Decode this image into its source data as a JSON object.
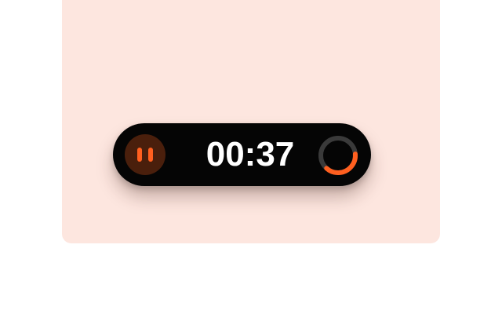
{
  "timer": {
    "time": "00:37",
    "state": "running",
    "progress": 0.38,
    "pause_icon": "pause-icon"
  },
  "colors": {
    "accent": "#ff5f1f",
    "pill_background": "#050505",
    "pause_button_background": "#4a1f0c",
    "ring_track": "#3a3a3a",
    "stage_background": "#fde6df"
  }
}
